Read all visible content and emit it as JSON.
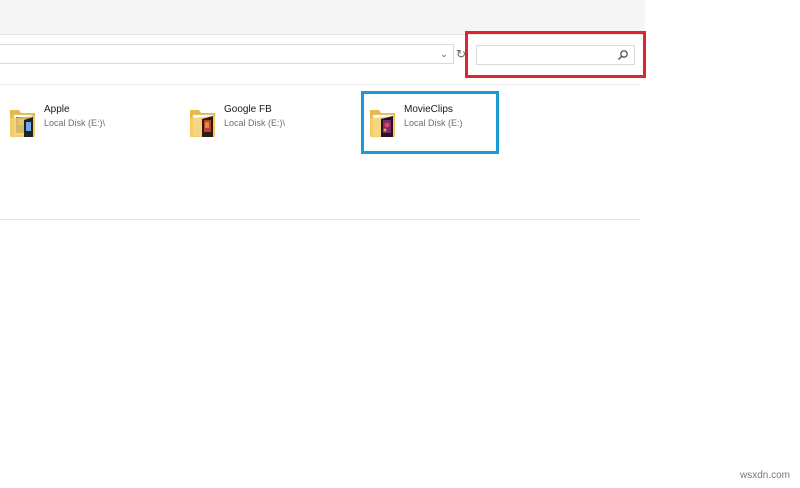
{
  "search": {
    "placeholder": "",
    "value": ""
  },
  "folders": [
    {
      "name": "Apple",
      "location": "Local Disk (E:)\\",
      "icon": "folder-icon"
    },
    {
      "name": "Google FB",
      "location": "Local Disk (E:)\\",
      "icon": "folder-icon"
    },
    {
      "name": "MovieClips",
      "location": "Local Disk (E:)",
      "icon": "folder-icon"
    }
  ],
  "icons": {
    "address_dropdown": "chevron-down-icon",
    "refresh": "refresh-icon",
    "search": "search-icon"
  },
  "colors": {
    "highlight_search": "#e0232f",
    "highlight_folder": "#1a9ad6",
    "folder_yellow": "#f4cf6a"
  },
  "watermark": "wsxdn.com"
}
